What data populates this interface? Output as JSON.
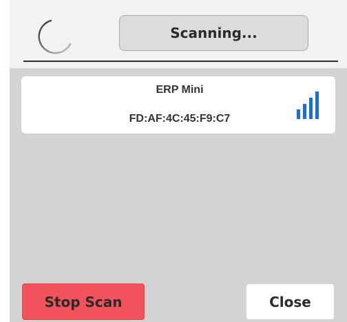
{
  "header": {
    "status_text": "Scanning...",
    "spinner_icon": "loading-spinner-icon"
  },
  "devices": [
    {
      "name": "ERP Mini",
      "address": "FD:AF:4C:45:F9:C7",
      "signal_icon": "signal-strength-icon",
      "signal_bars_active": 4,
      "signal_bars_total": 4
    }
  ],
  "footer": {
    "stop_label": "Stop Scan",
    "close_label": "Close"
  },
  "colors": {
    "stop_button": "#f2525a",
    "signal": "#1a6fe0",
    "panel": "#d3d3d3",
    "header": "#f2f2f2"
  }
}
